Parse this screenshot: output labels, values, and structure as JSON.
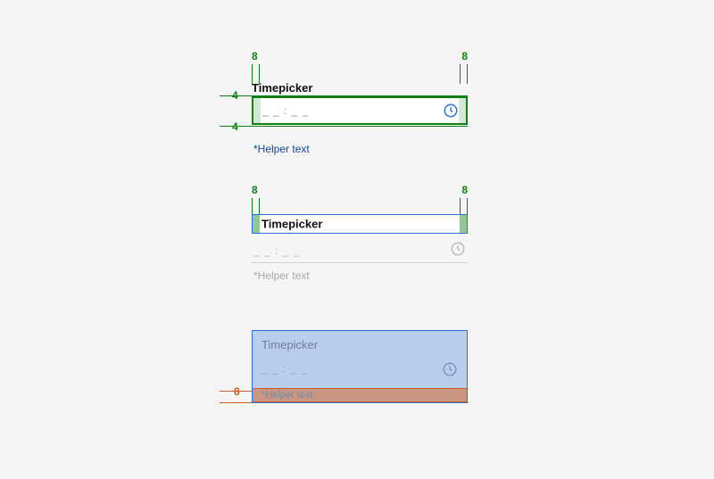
{
  "specs": {
    "s1": {
      "guide_top_left": "8",
      "guide_top_right": "8",
      "guide_left_upper": "4",
      "guide_left_lower": "4",
      "label": "Timepicker",
      "placeholder": "_ _  :  _ _",
      "helper": "*Helper text",
      "guide_color": "#0f8014",
      "helper_color": "#16468f"
    },
    "s2": {
      "guide_top_left": "8",
      "guide_top_right": "8",
      "label": "Timepicker",
      "placeholder": "_ _  :  _ _",
      "helper": "*Helper text",
      "box_border": "#2d71d6",
      "pad_fill": "#0f8014"
    },
    "s3": {
      "guide_left": "8",
      "label": "Timepicker",
      "placeholder": "_ _  :  _ _",
      "helper": "*Helper text",
      "overlay_fill": "rgba(45,113,214,.30)",
      "band_color": "#d05a1e"
    }
  },
  "icons": {
    "clock": "clock-icon"
  }
}
